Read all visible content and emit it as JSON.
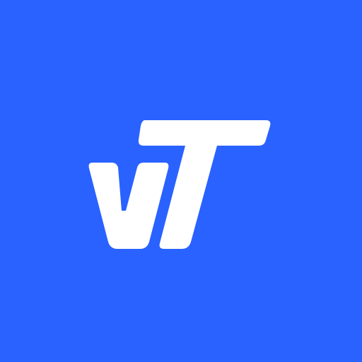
{
  "logo": {
    "text": "vT",
    "background_color": "#2962FF",
    "foreground_color": "#FFFFFF"
  }
}
